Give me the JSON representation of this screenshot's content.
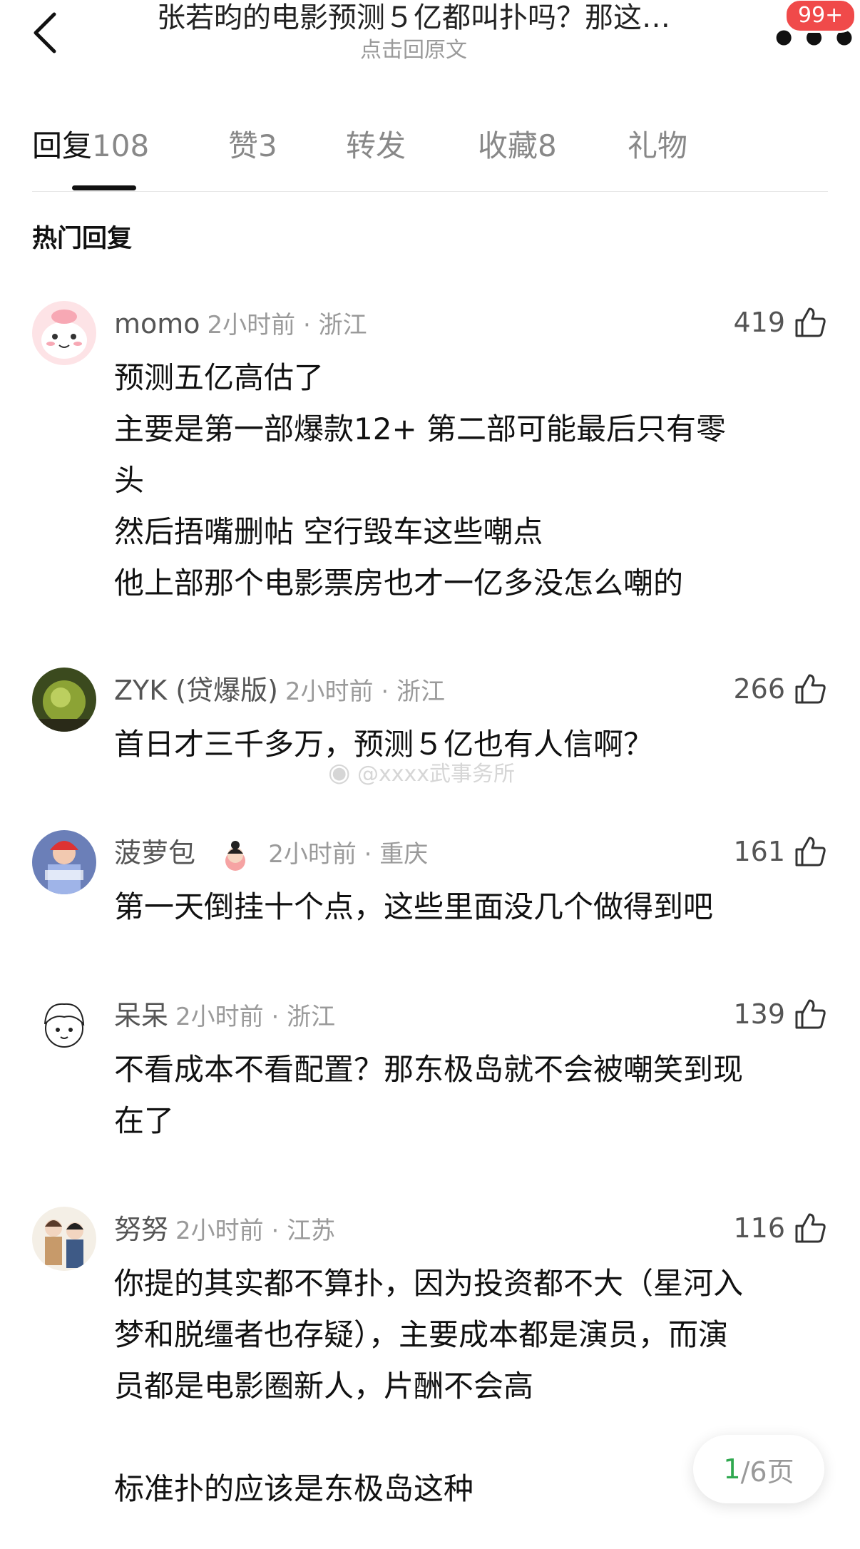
{
  "header": {
    "title": "张若昀的电影预测５亿都叫扑吗？那这…",
    "subtitle": "点击回原文",
    "badge": "99+"
  },
  "tabs": [
    {
      "label": "回复",
      "count": "108"
    },
    {
      "label": "赞",
      "count": "3"
    },
    {
      "label": "转发",
      "count": ""
    },
    {
      "label": "收藏",
      "count": "8"
    },
    {
      "label": "礼物",
      "count": ""
    }
  ],
  "section_title": "热门回复",
  "comments": [
    {
      "name": "momo",
      "time": "2小时前 · 浙江",
      "likes": "419",
      "text": "预测五亿高估了\n主要是第一部爆款12+ 第二部可能最后只有零\n头\n然后捂嘴删帖 空行毁车这些嘲点\n他上部那个电影票房也才一亿多没怎么嘲的"
    },
    {
      "name": "ZYK (贷爆版)",
      "time": "2小时前 · 浙江",
      "likes": "266",
      "text": "首日才三千多万，预测５亿也有人信啊？"
    },
    {
      "name": "菠萝包",
      "time": "2小时前 · 重庆",
      "likes": "161",
      "text": "第一天倒挂十个点，这些里面没几个做得到吧"
    },
    {
      "name": "呆呆",
      "time": "2小时前 · 浙江",
      "likes": "139",
      "text": "不看成本不看配置？那东极岛就不会被嘲笑到现\n在了"
    },
    {
      "name": "努努",
      "time": "2小时前 · 江苏",
      "likes": "116",
      "text": "你提的其实都不算扑，因为投资都不大（星河入\n梦和脱缰者也存疑），主要成本都是演员，而演\n员都是电影圈新人，片酬不会高\n\n标准扑的应该是东极岛这种"
    }
  ],
  "watermark": "@xxxx武事务所",
  "pagination": {
    "current": "1",
    "total": "/6页"
  }
}
